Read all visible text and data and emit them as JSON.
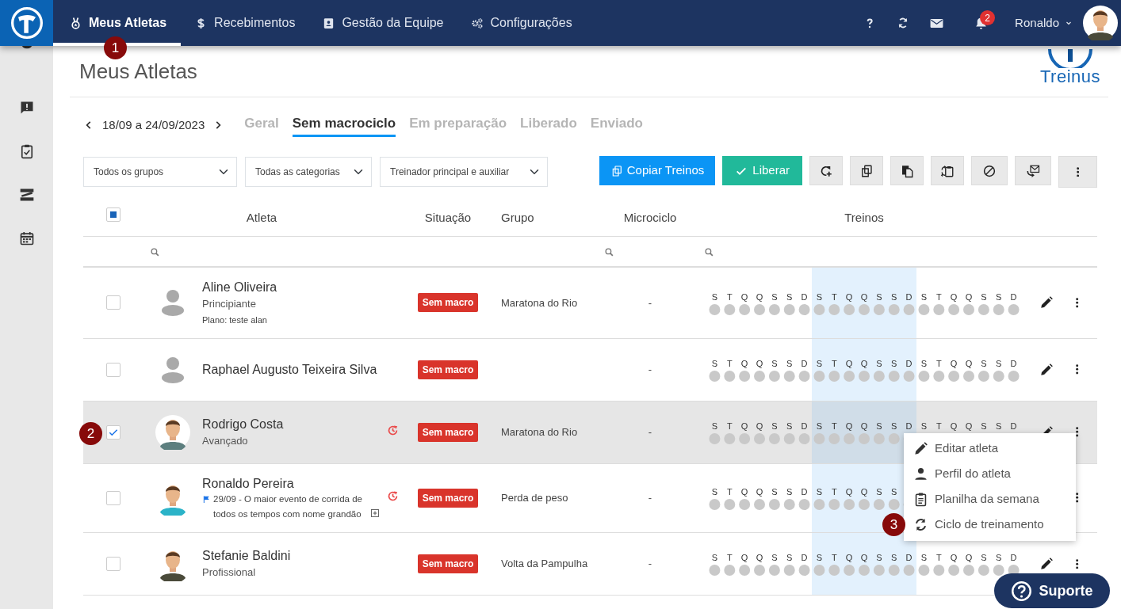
{
  "navbar": {
    "items": [
      {
        "label": "Meus Atletas",
        "selected": true
      },
      {
        "label": "Recebimentos",
        "selected": false
      },
      {
        "label": "Gestão da Equipe",
        "selected": false
      },
      {
        "label": "Configurações",
        "selected": false
      }
    ],
    "notification_count": "2",
    "user": "Ronaldo"
  },
  "page": {
    "title": "Meus Atletas",
    "brand": "Treinus"
  },
  "week_nav": {
    "range": "18/09 a 24/09/2023"
  },
  "tabs": [
    {
      "label": "Geral",
      "selected": false
    },
    {
      "label": "Sem macrociclo",
      "selected": true
    },
    {
      "label": "Em preparação",
      "selected": false
    },
    {
      "label": "Liberado",
      "selected": false
    },
    {
      "label": "Enviado",
      "selected": false
    }
  ],
  "filters": [
    {
      "value": "Todos os grupos"
    },
    {
      "value": "Todas as categorias"
    },
    {
      "value": "Treinador principal e auxiliar"
    }
  ],
  "toolbar": {
    "buttons": [
      {
        "label": "Copiar Treinos",
        "kind": "primary"
      },
      {
        "label": "Liberar",
        "kind": "success"
      }
    ]
  },
  "table": {
    "select_all_partial": true,
    "columns": [
      "Atleta",
      "Situação",
      "Grupo",
      "Microciclo",
      "Treinos"
    ],
    "rows": [
      {
        "name": "Aline Oliveira",
        "category": "Principiante",
        "plan": "Plano: teste alan",
        "avatar_placeholder": true,
        "history": false,
        "status": "Sem macro",
        "group": "Maratona do Rio",
        "microcycle": "-",
        "checked": false,
        "edit_icon": true,
        "weeks": [
          {
            "current": false,
            "dots": true,
            "days": [
              "S",
              "T",
              "Q",
              "Q",
              "S",
              "S",
              "D"
            ]
          },
          {
            "current": true,
            "dots": true,
            "days": [
              "S",
              "T",
              "Q",
              "Q",
              "S",
              "S",
              "D"
            ]
          },
          {
            "current": false,
            "dots": true,
            "days": [
              "S",
              "T",
              "Q",
              "Q",
              "S",
              "S",
              "D"
            ]
          }
        ]
      },
      {
        "name": "Raphael Augusto Teixeira Silva",
        "avatar_placeholder": true,
        "history": false,
        "status": "Sem macro",
        "microcycle": "-",
        "checked": false,
        "edit_icon": true,
        "weeks": [
          {
            "current": false,
            "dots": true,
            "days": [
              "S",
              "T",
              "Q",
              "Q",
              "S",
              "S",
              "D"
            ]
          },
          {
            "current": true,
            "dots": true,
            "days": [
              "S",
              "T",
              "Q",
              "Q",
              "S",
              "S",
              "D"
            ]
          },
          {
            "current": false,
            "dots": true,
            "days": [
              "S",
              "T",
              "Q",
              "Q",
              "S",
              "S",
              "D"
            ]
          }
        ]
      },
      {
        "name": "Rodrigo Costa",
        "category": "Avançado",
        "avatar_placeholder": false,
        "history": true,
        "status": "Sem macro",
        "group": "Maratona do Rio",
        "microcycle": "-",
        "checked": true,
        "edit_icon": true,
        "weeks": [
          {
            "current": false,
            "dots": true,
            "days": [
              "S",
              "T",
              "Q",
              "Q",
              "S",
              "S",
              "D"
            ]
          },
          {
            "current": true,
            "dots": true,
            "days": [
              "S",
              "T",
              "Q",
              "Q",
              "S",
              "S",
              "D"
            ]
          },
          {
            "current": false,
            "dots": false,
            "days": [
              "S",
              "T",
              "Q",
              "Q",
              "S",
              "S",
              "D"
            ]
          }
        ],
        "menu": [
          {
            "label": "Editar atleta"
          },
          {
            "label": "Perfil do atleta"
          },
          {
            "label": "Planilha da semana"
          },
          {
            "label": "Ciclo de treinamento"
          }
        ]
      },
      {
        "name": "Ronaldo Pereira",
        "note": "29/09 - O maior evento de corrida de todos os tempos com nome grandão",
        "avatar_placeholder": false,
        "history": true,
        "status": "Sem macro",
        "group": "Perda de peso",
        "microcycle": "-",
        "checked": false,
        "edit_icon": false,
        "weeks": [
          {
            "current": false,
            "dots": true,
            "days": [
              "S",
              "T",
              "Q",
              "Q",
              "S",
              "S",
              "D"
            ]
          },
          {
            "current": true,
            "dots": true,
            "days": [
              "S",
              "T",
              "Q",
              "Q",
              "S",
              "S"
            ]
          }
        ]
      },
      {
        "name": "Stefanie Baldini",
        "category": "Profissional",
        "avatar_placeholder": false,
        "history": false,
        "status": "Sem macro",
        "group": "Volta da Pampulha",
        "microcycle": "-",
        "checked": false,
        "edit_icon": true,
        "weeks": [
          {
            "current": false,
            "dots": true,
            "days": [
              "S",
              "T",
              "Q",
              "Q",
              "S",
              "S",
              "D"
            ]
          },
          {
            "current": true,
            "dots": true,
            "days": [
              "S",
              "T",
              "Q",
              "Q",
              "S",
              "S",
              "D"
            ]
          },
          {
            "current": false,
            "dots": true,
            "days": [
              "S",
              "T",
              "Q",
              "Q",
              "S",
              "S",
              "D"
            ]
          }
        ]
      }
    ]
  },
  "callouts": [
    "1",
    "2",
    "3"
  ],
  "support_button": "Suporte"
}
